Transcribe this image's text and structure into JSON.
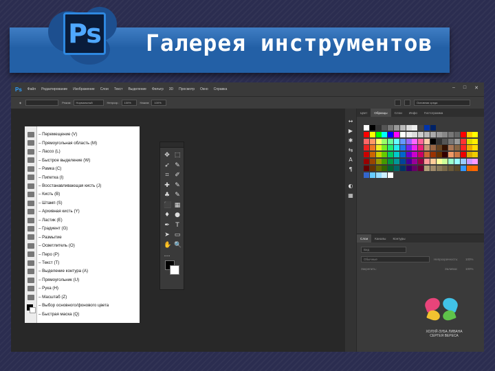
{
  "slide": {
    "title": "Галерея инструментов"
  },
  "logo": {
    "text": "Ps"
  },
  "app": {
    "logo": "Ps",
    "menu": [
      "Файл",
      "Редактирование",
      "Изображение",
      "Слои",
      "Текст",
      "Выделение",
      "Фильтр",
      "3D",
      "Просмотр",
      "Окно",
      "Справка"
    ],
    "window_controls": [
      "–",
      "□",
      "✕"
    ],
    "options": {
      "mode_label": "Режим:",
      "mode_value": "Нормальный",
      "opacity_label": "Непрозр.:",
      "opacity_value": "100%",
      "flow_label": "Нажим:",
      "flow_value": "100%",
      "workspace": "Основная среда"
    }
  },
  "tool_list": [
    "– Перемещение (V)",
    "– Прямоугольная область (M)",
    "– Лассо (L)",
    "– Быстрое выделение (W)",
    "– Рамка (С)",
    "– Пипетка (I)",
    "– Восстанавливающая кисть (J)",
    "– Кисть (B)",
    "– Штамп (S)",
    "– Архивная кисть (Y)",
    "– Ластик (E)",
    "– Градиент (G)",
    "– Размытие",
    "– Осветлитель (O)",
    "– Перо (P)",
    "– Текст (T)",
    "– Выделение контура (A)",
    "– Прямоугольник (U)",
    "– Рука (H)",
    "– Масштаб (Z)",
    "– Выбор основного/фонового цвета",
    "– Быстрая маска (Q)"
  ],
  "tool_icons": [
    "✥",
    "⬚",
    "➶",
    "✎",
    "⌗",
    "✐",
    "✚",
    "✎",
    "♣",
    "✎",
    "⬛",
    "▦",
    "♦",
    "●",
    "✒",
    "T",
    "➤",
    "▭",
    "✋",
    "🔍",
    "…"
  ],
  "side_icons": [
    "↔",
    "▶",
    "✱",
    "⇆",
    "A",
    "¶",
    "◐",
    "▦"
  ],
  "panels": {
    "swatches_tabs": [
      "Цвет",
      "Образцы",
      "Слои",
      "Инфо",
      "Гистограмма"
    ],
    "layers_tabs": [
      "Слои",
      "Каналы",
      "Контуры"
    ],
    "kind_placeholder": "Вид",
    "blend_mode": "Обычные",
    "opacity_label": "Непрозрачность:",
    "opacity_value": "100%",
    "lock_label": "Закрепить:",
    "fill_label": "Заливка:",
    "fill_value": "100%"
  },
  "swatch_colors": [
    [
      "#ffffff",
      "#000000",
      "#333333",
      "#555555",
      "#777777",
      "#999999",
      "#bbbbbb",
      "#dddddd",
      "#eeeeee",
      "#444444",
      "#0033aa",
      "#002266",
      "#000000",
      "#000000",
      "#000000",
      "#000000",
      "#000000",
      "#000000",
      "#000000"
    ],
    [
      "#ff0000",
      "#ffff00",
      "#00ff00",
      "#00ffff",
      "#0000ff",
      "#ff00ff",
      "#ffffff",
      "#eeeeee",
      "#dddddd",
      "#cccccc",
      "#bbbbbb",
      "#aaaaaa",
      "#999999",
      "#888888",
      "#777777",
      "#666666",
      "#ff0000",
      "#ffcc00",
      "#ffff00"
    ],
    [
      "#ff6666",
      "#ff9966",
      "#ffff66",
      "#99ff66",
      "#66ff99",
      "#66ffff",
      "#6699ff",
      "#9966ff",
      "#ff66ff",
      "#ff6699",
      "#ffccaa",
      "#000000",
      "#333333",
      "#555555",
      "#777777",
      "#999999",
      "#ff3333",
      "#dddd00",
      "#ffee00"
    ],
    [
      "#ee2222",
      "#ee7722",
      "#eeee22",
      "#77ee22",
      "#22ee77",
      "#22eeee",
      "#2277ee",
      "#7722ee",
      "#ee22ee",
      "#ee2277",
      "#cc9977",
      "#996644",
      "#664422",
      "#331100",
      "#aa7755",
      "#886644",
      "#ff2222",
      "#eeaa00",
      "#ffdd00"
    ],
    [
      "#cc0000",
      "#cc6600",
      "#cccc00",
      "#66cc00",
      "#00cc66",
      "#00cccc",
      "#0066cc",
      "#6600cc",
      "#cc00cc",
      "#cc0066",
      "#cc6633",
      "#993300",
      "#663300",
      "#330000",
      "#ee9966",
      "#cc7744",
      "#ee0000",
      "#ddaa00",
      "#eecc00"
    ],
    [
      "#990000",
      "#994400",
      "#999900",
      "#449900",
      "#009944",
      "#009999",
      "#004499",
      "#440099",
      "#990099",
      "#990044",
      "#ff9999",
      "#ffcc99",
      "#ffff99",
      "#ccff99",
      "#99ffcc",
      "#99ffff",
      "#99ccff",
      "#cc99ff",
      "#ff99ff"
    ],
    [
      "#660000",
      "#663300",
      "#666600",
      "#336600",
      "#006633",
      "#006666",
      "#003366",
      "#330066",
      "#660066",
      "#660033",
      "#b3a07a",
      "#a08a6a",
      "#8a7a5a",
      "#7a6a4a",
      "#6a5a3a",
      "#5a4a2a",
      "#3399ff",
      "#ee6600",
      "#ff6600"
    ],
    [
      "#3366cc",
      "#66ccff",
      "#99ddff",
      "#ccefff",
      "#ffffff",
      "#000000",
      "#000000",
      "#000000",
      "#000000",
      "#000000",
      "#000000",
      "#000000",
      "#000000",
      "#000000",
      "#000000",
      "#000000",
      "#000000",
      "#000000",
      "#000000"
    ]
  ],
  "watermark": {
    "line1": "ХОЛУЙ-ЗУБА ЛИВАНА",
    "line2": "СЕРГЕЯ ВЕРЕСА"
  }
}
